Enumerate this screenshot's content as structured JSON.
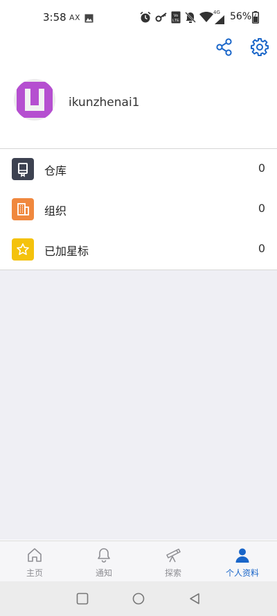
{
  "status_bar": {
    "time": "3:58",
    "ax": "AX",
    "battery": "56%",
    "network": "4G"
  },
  "toolbar": {
    "share_icon": "share-icon",
    "settings_icon": "gear-icon"
  },
  "profile": {
    "username": "ikunzhenai1"
  },
  "menu": [
    {
      "label": "仓库",
      "count": "0",
      "icon": "repo-icon",
      "color": "#3d4251"
    },
    {
      "label": "组织",
      "count": "0",
      "icon": "organization-icon",
      "color": "#f0883e"
    },
    {
      "label": "已加星标",
      "count": "0",
      "icon": "star-icon",
      "color": "#f4c20d"
    }
  ],
  "bottom_nav": [
    {
      "label": "主页",
      "icon": "home-icon"
    },
    {
      "label": "通知",
      "icon": "bell-icon"
    },
    {
      "label": "探索",
      "icon": "telescope-icon"
    },
    {
      "label": "个人资料",
      "icon": "person-icon",
      "active": true
    }
  ],
  "colors": {
    "accent": "#1a66c9",
    "background_gray": "#efeff4"
  }
}
